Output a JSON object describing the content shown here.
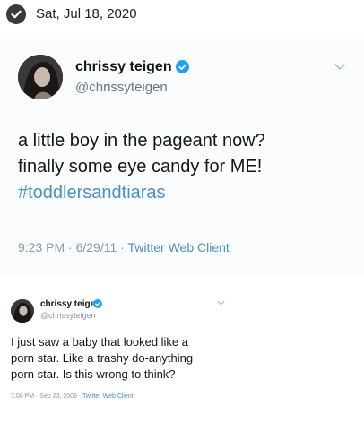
{
  "header": {
    "date": "Sat, Jul 18, 2020",
    "check_icon": "check-circle-icon"
  },
  "tweet1": {
    "name": "chrissy teigen",
    "handle": "@chrissyteigen",
    "body_lines": [
      "a little boy in the pageant now?",
      "finally some eye candy for ME!"
    ],
    "hashtag": "#toddlersandtiaras",
    "time": "9:23 PM · 6/29/11 · ",
    "client": "Twitter Web Client",
    "verified_color": "#1da1f2",
    "link_color": "#4a90c8"
  },
  "tweet2": {
    "name": "chrissy teigen",
    "handle": "@chrissyteigen",
    "body_lines": [
      "I just saw a baby that looked like a",
      "porn star. Like a trashy do-anything",
      "porn star. Is this wrong to think?"
    ],
    "time": "7:08 PM · Sep 23, 2009 · ",
    "client": "Twitter Web Client"
  }
}
